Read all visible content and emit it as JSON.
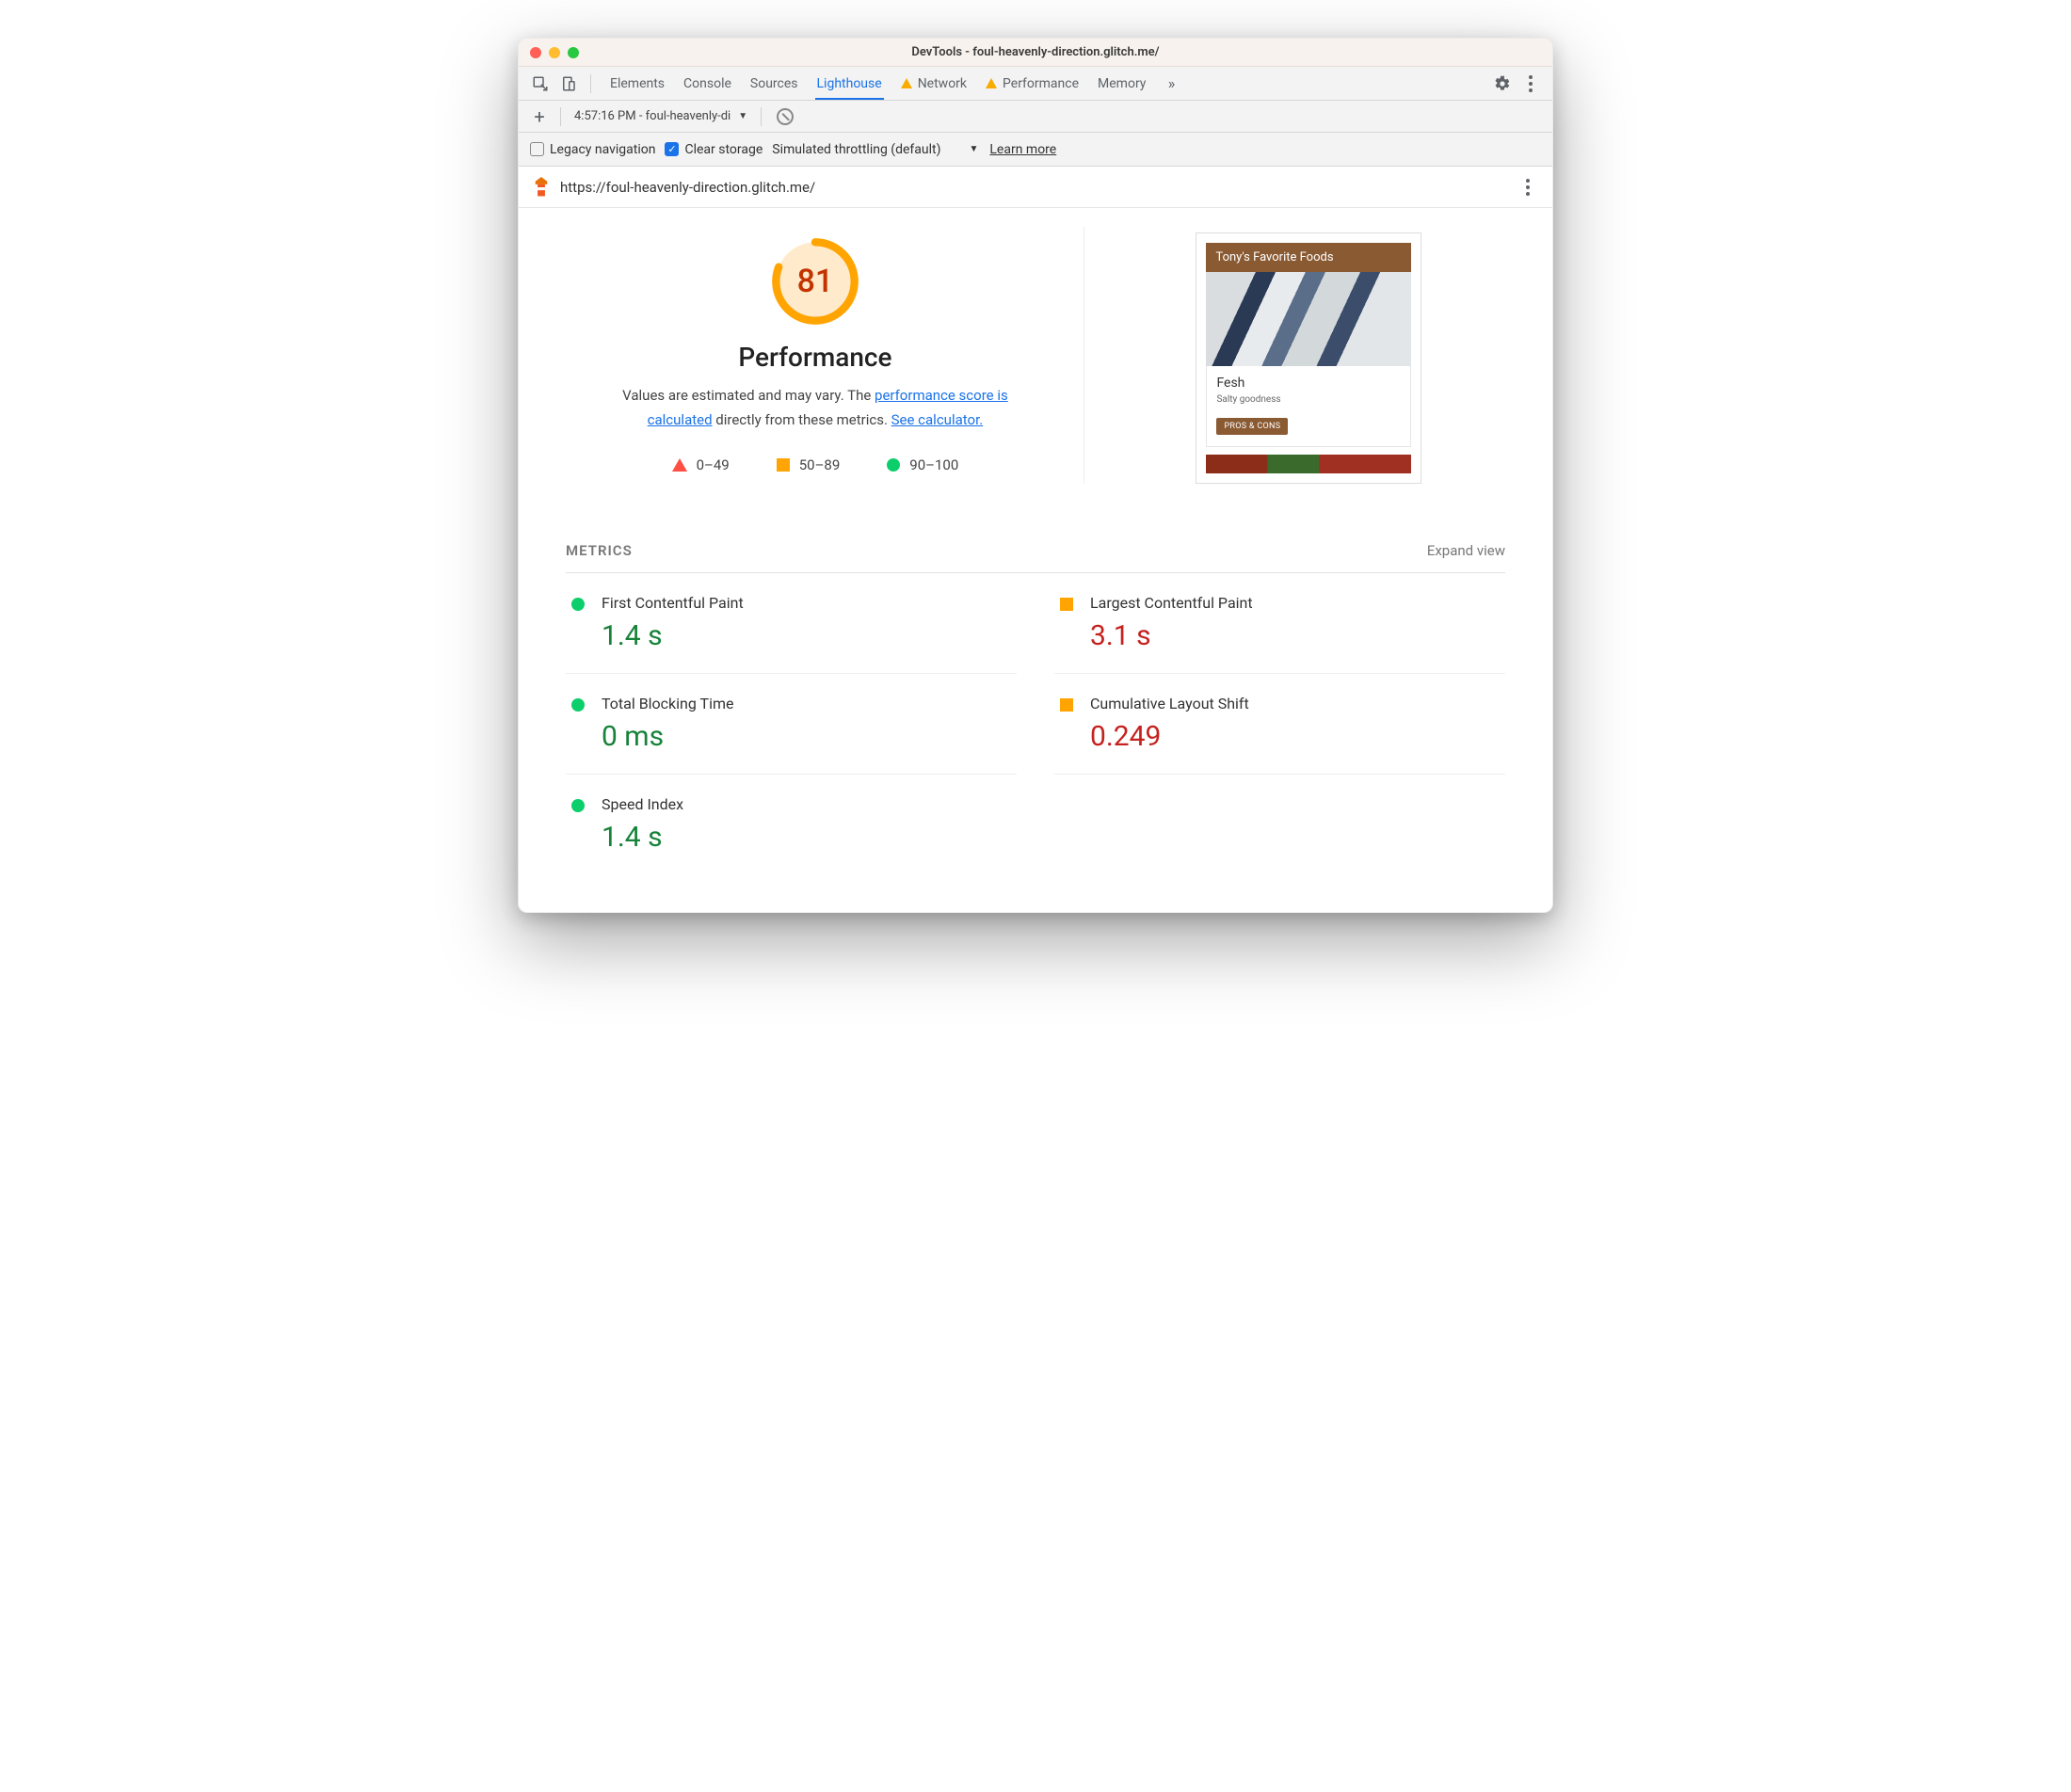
{
  "window": {
    "title": "DevTools - foul-heavenly-direction.glitch.me/"
  },
  "tabs": {
    "items": [
      "Elements",
      "Console",
      "Sources",
      "Lighthouse",
      "Network",
      "Performance",
      "Memory"
    ],
    "active": "Lighthouse",
    "warn": [
      "Network",
      "Performance"
    ]
  },
  "subtoolbar": {
    "run_label": "4:57:16 PM - foul-heavenly-di"
  },
  "options": {
    "legacy_label": "Legacy navigation",
    "clear_label": "Clear storage",
    "throttle_label": "Simulated throttling (default)",
    "learn_label": "Learn more"
  },
  "url_row": {
    "url": "https://foul-heavenly-direction.glitch.me/"
  },
  "score": {
    "value": "81",
    "title": "Performance",
    "desc_pre": "Values are estimated and may vary. The ",
    "link1": "performance score is calculated",
    "desc_mid": " directly from these metrics. ",
    "link2": "See calculator."
  },
  "legend": {
    "r1": "0–49",
    "r2": "50–89",
    "r3": "90–100"
  },
  "preview": {
    "header": "Tony's Favorite Foods",
    "card_title": "Fesh",
    "card_sub": "Salty goodness",
    "card_btn": "PROS & CONS"
  },
  "metrics": {
    "heading": "METRICS",
    "expand": "Expand view",
    "items": [
      {
        "label": "First Contentful Paint",
        "value": "1.4 s",
        "status": "green"
      },
      {
        "label": "Largest Contentful Paint",
        "value": "3.1 s",
        "status": "orange"
      },
      {
        "label": "Total Blocking Time",
        "value": "0 ms",
        "status": "green"
      },
      {
        "label": "Cumulative Layout Shift",
        "value": "0.249",
        "status": "orange"
      },
      {
        "label": "Speed Index",
        "value": "1.4 s",
        "status": "green"
      }
    ]
  },
  "chart_data": {
    "type": "table",
    "title": "Lighthouse Performance Metrics",
    "score": 81,
    "metrics": [
      {
        "name": "First Contentful Paint",
        "value": 1.4,
        "unit": "s",
        "rating": "good"
      },
      {
        "name": "Largest Contentful Paint",
        "value": 3.1,
        "unit": "s",
        "rating": "needs-improvement"
      },
      {
        "name": "Total Blocking Time",
        "value": 0,
        "unit": "ms",
        "rating": "good"
      },
      {
        "name": "Cumulative Layout Shift",
        "value": 0.249,
        "unit": "",
        "rating": "needs-improvement"
      },
      {
        "name": "Speed Index",
        "value": 1.4,
        "unit": "s",
        "rating": "good"
      }
    ],
    "legend_ranges": {
      "poor": "0–49",
      "average": "50–89",
      "good": "90–100"
    }
  }
}
